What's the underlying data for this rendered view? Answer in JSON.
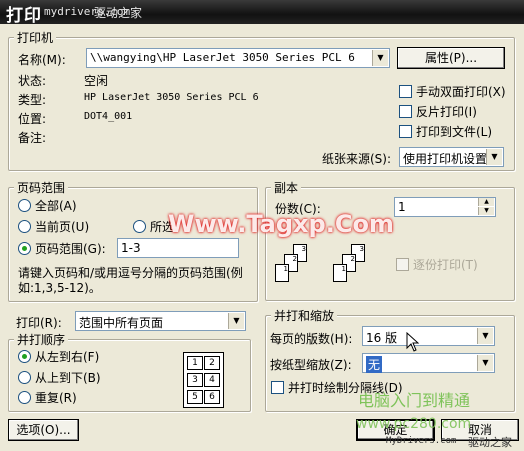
{
  "window": {
    "title": "打印",
    "title_watermark_url": "mydrivers.com",
    "title_watermark_cn": "驱动之家"
  },
  "printer_group": {
    "label": "打印机",
    "name_label": "名称(M):",
    "name_value": "\\\\wangying\\HP LaserJet 3050 Series PCL 6",
    "properties_button": "属性(P)...",
    "status_label": "状态:",
    "status_value": "空闲",
    "type_label": "类型:",
    "type_value": "HP LaserJet 3050 Series PCL 6",
    "where_label": "位置:",
    "where_value": "DOT4_001",
    "comment_label": "备注:",
    "manual_duplex": "手动双面打印(X)",
    "reverse_print": "反片打印(I)",
    "print_to_file": "打印到文件(L)",
    "paper_source_label": "纸张来源(S):",
    "paper_source_value": "使用打印机设置"
  },
  "page_range": {
    "label": "页码范围",
    "all": "全部(A)",
    "current": "当前页(U)",
    "selection": "所选",
    "pages": "页码范围(G):",
    "pages_value": "1-3",
    "hint": "请键入页码和/或用逗号分隔的页码范围(例如:1,3,5-12)。"
  },
  "copies": {
    "label": "副本",
    "count_label": "份数(C):",
    "count_value": "1",
    "collate": "逐份打印(T)",
    "page_numbers": [
      "1",
      "2",
      "3"
    ]
  },
  "print_what": {
    "label": "打印(R):",
    "value": "范围中所有页面"
  },
  "order": {
    "label": "并打顺序",
    "left_to_right": "从左到右(F)",
    "top_to_bottom": "从上到下(B)",
    "repeat": "重复(R)",
    "cells": [
      "1",
      "2",
      "3",
      "4",
      "5",
      "6"
    ]
  },
  "zoom": {
    "label": "并打和缩放",
    "pages_per_sheet_label": "每页的版数(H):",
    "pages_per_sheet_value": "16 版",
    "scale_label": "按纸型缩放(Z):",
    "scale_value": "无",
    "draw_borders": "并打时绘制分隔线(D)"
  },
  "buttons": {
    "options": "选项(O)...",
    "ok": "确定",
    "cancel": "取消"
  },
  "watermarks": {
    "center": "Www.Tagxp.Com",
    "green": "电脑入门到精通",
    "green_url": "www.pc280.com",
    "footer_url": "MyDrivers.com",
    "footer_cn": "驱动之家"
  }
}
